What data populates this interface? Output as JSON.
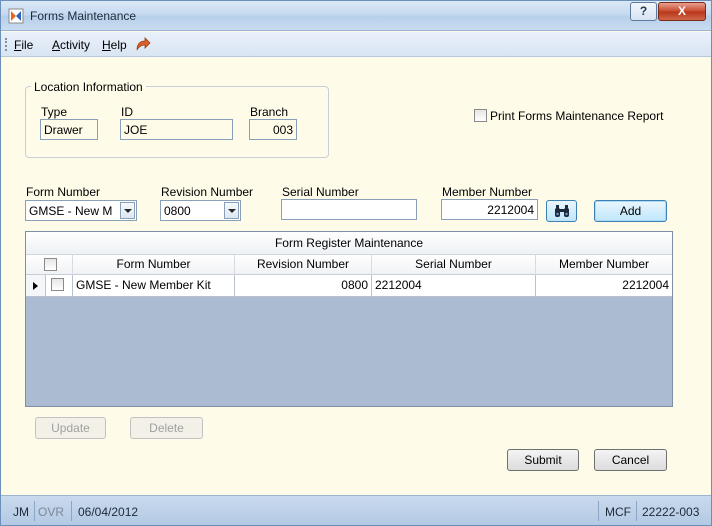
{
  "window": {
    "title": "Forms Maintenance"
  },
  "titlebar_buttons": {
    "help": "?",
    "close": "X"
  },
  "menu": {
    "file": "File",
    "activity": "Activity",
    "help": "Help"
  },
  "location": {
    "group_title": "Location Information",
    "type_label": "Type",
    "type_value": "Drawer",
    "id_label": "ID",
    "id_value": "JOE",
    "branch_label": "Branch",
    "branch_value": "003"
  },
  "print_report": {
    "label": "Print Forms Maintenance Report",
    "checked": false
  },
  "form_fields": {
    "form_number_label": "Form Number",
    "form_number_value": "GMSE - New M",
    "revision_number_label": "Revision Number",
    "revision_number_value": "0800",
    "serial_number_label": "Serial Number",
    "serial_number_value": "",
    "member_number_label": "Member Number",
    "member_number_value": "2212004",
    "add_label": "Add"
  },
  "grid": {
    "caption": "Form Register Maintenance",
    "columns": [
      "Form Number",
      "Revision Number",
      "Serial Number",
      "Member Number"
    ],
    "rows": [
      {
        "form_number": "GMSE - New Member Kit",
        "revision_number": "0800",
        "serial_number": "2212004",
        "member_number": "2212004",
        "checked": false
      }
    ]
  },
  "actions": {
    "update": "Update",
    "delete": "Delete",
    "submit": "Submit",
    "cancel": "Cancel"
  },
  "status": {
    "user": "JM",
    "mode": "OVR",
    "date": "06/04/2012",
    "system": "MCF",
    "account": "22222-003"
  },
  "colors": {
    "window_bg": "#fefbe9",
    "grid_bg": "#abbbd1",
    "status_bg": "#b3c9e3",
    "close_red": "#c7472a"
  }
}
